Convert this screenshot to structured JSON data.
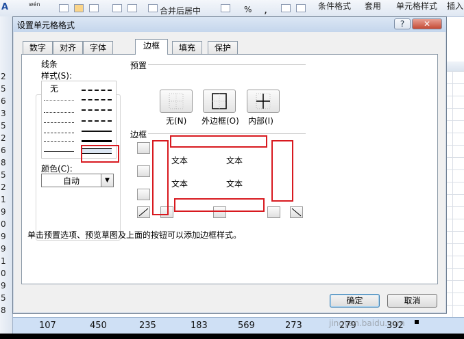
{
  "ribbon": {
    "items": [
      "条件格式",
      "套用",
      "单元格样式",
      "插入"
    ],
    "merge_label": "合并后居中",
    "misc": [
      "%",
      ",",
      "A",
      "wén"
    ]
  },
  "row_numbers": [
    "2",
    "5",
    "6",
    "3",
    "5",
    "2",
    "6",
    "8",
    "5",
    "2",
    "1",
    "9",
    "0",
    "9",
    "9",
    "1",
    "0",
    "9",
    "5",
    "8"
  ],
  "data_row": [
    "107",
    "450",
    "235",
    "183",
    "569",
    "273",
    "279",
    "392"
  ],
  "dialog": {
    "title": "设置单元格格式",
    "help": "?",
    "close": "✕",
    "tabs": [
      "数字",
      "对齐",
      "字体",
      "边框",
      "填充",
      "保护"
    ],
    "active_tab": "边框",
    "line_group": "线条",
    "style_label": "样式(S):",
    "style_none": "无",
    "color_label": "颜色(C):",
    "color_value": "自动",
    "presets_label": "预置",
    "presets": [
      "无(N)",
      "外边框(O)",
      "内部(I)"
    ],
    "border_label": "边框",
    "preview_texts": [
      "文本",
      "文本",
      "文本",
      "文本"
    ],
    "hint": "单击预置选项、预览草图及上面的按钮可以添加边框样式。",
    "ok": "确定",
    "cancel": "取消"
  },
  "watermark": "jingyan.baidu.com",
  "colors": {
    "highlight": "#d8191f",
    "selection": "#cfe0f5"
  }
}
